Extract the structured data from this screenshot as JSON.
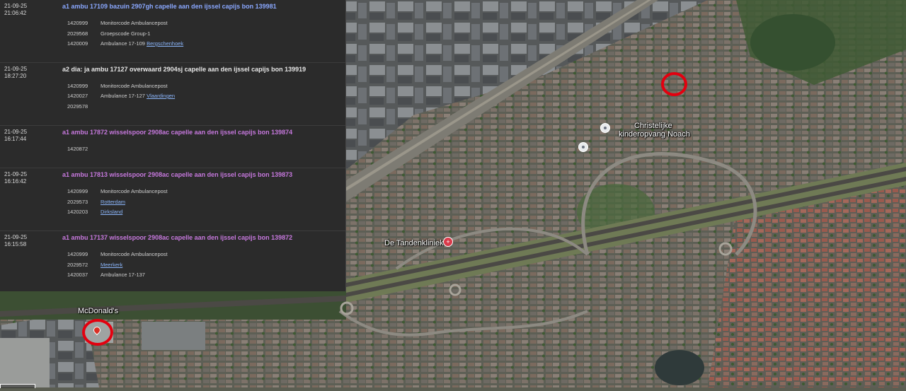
{
  "map": {
    "labels": {
      "kinderopvang_line1": "Christelijke",
      "kinderopvang_line2": "kinderopvang Noach",
      "tandenkliniek": "De Tandenkliniek",
      "mcdonalds": "McDonald's"
    },
    "icons": [
      "poi-pin-icon",
      "dental-clinic-icon",
      "restaurant-pin-icon",
      "incident-marker-ring"
    ]
  },
  "panel": {
    "entries": [
      {
        "date": "21-09-25",
        "time": "21:06:42",
        "title": "a1 ambu 17109 bazuin 2907gh capelle aan den ijssel capijs bon 139981",
        "rows": [
          {
            "code": "1420999",
            "text": "Monitorcode Ambulancepost",
            "link": ""
          },
          {
            "code": "2029568",
            "text": "Groepscode Group-1",
            "link": ""
          },
          {
            "code": "1420009",
            "text": "Ambulance 17-109",
            "link": "Bergschenhoek"
          }
        ]
      },
      {
        "date": "21-09-25",
        "time": "18:27:20",
        "title": "a2 dia: ja ambu 17127 overwaard 2904sj capelle aan den ijssel capijs bon 139919",
        "rows": [
          {
            "code": "1420999",
            "text": "Monitorcode Ambulancepost",
            "link": ""
          },
          {
            "code": "1420027",
            "text": "Ambulance 17-127",
            "link": "Vlaardingen"
          },
          {
            "code": "2029578",
            "text": "",
            "link": ""
          }
        ]
      },
      {
        "date": "21-09-25",
        "time": "16:17:44",
        "title": "a1 ambu 17872 wisselspoor 2908ac capelle aan den ijssel capijs bon 139874",
        "rows": [
          {
            "code": "1420872",
            "text": "",
            "link": ""
          }
        ]
      },
      {
        "date": "21-09-25",
        "time": "16:16:42",
        "title": "a1 ambu 17813 wisselspoor 2908ac capelle aan den ijssel capijs bon 139873",
        "rows": [
          {
            "code": "1420999",
            "text": "Monitorcode Ambulancepost",
            "link": ""
          },
          {
            "code": "2029573",
            "text": "",
            "link": "Rotterdam"
          },
          {
            "code": "1420203",
            "text": "",
            "link": "Dirksland"
          }
        ]
      },
      {
        "date": "21-09-25",
        "time": "16:15:58",
        "title": "a1 ambu 17137 wisselspoor 2908ac capelle aan den ijssel capijs bon 139872",
        "rows": [
          {
            "code": "1420999",
            "text": "Monitorcode Ambulancepost",
            "link": ""
          },
          {
            "code": "2029572",
            "text": "",
            "link": "Meerkerk"
          },
          {
            "code": "1420037",
            "text": "Ambulance 17-137",
            "link": ""
          }
        ]
      }
    ]
  },
  "colors": {
    "priority_a1": "#c678dd",
    "priority_a1_first": "#8aa8ff",
    "priority_a2": "#e6e6e6",
    "panel_bg": "#2b2b2b",
    "marker_ring": "#e3000f"
  }
}
